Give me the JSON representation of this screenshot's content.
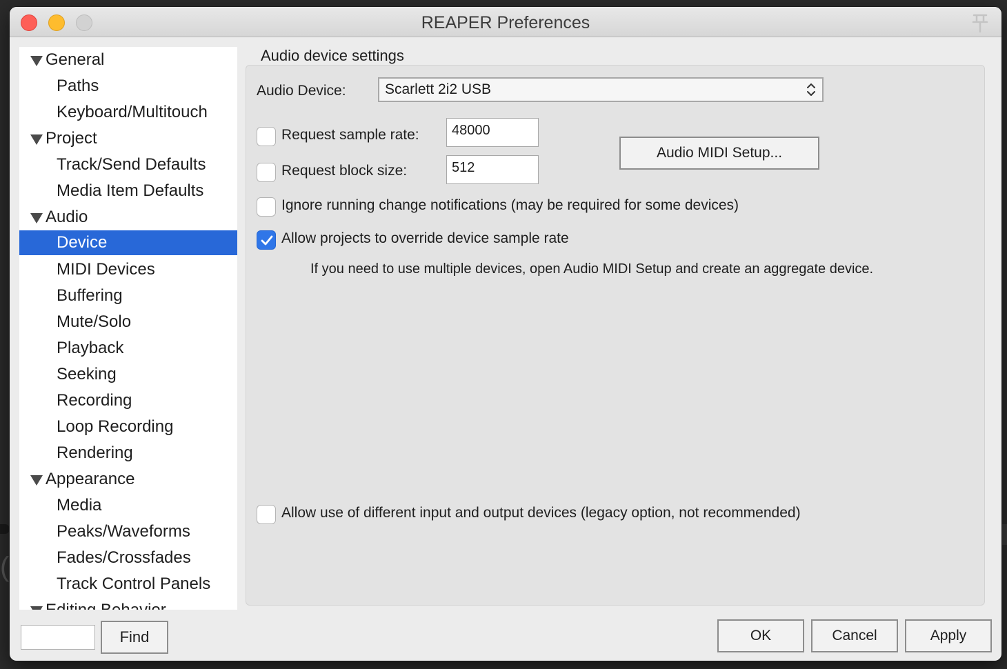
{
  "window": {
    "title": "REAPER Preferences"
  },
  "sidebar": {
    "items": [
      {
        "label": "General",
        "kind": "parent"
      },
      {
        "label": "Paths",
        "kind": "child"
      },
      {
        "label": "Keyboard/Multitouch",
        "kind": "child"
      },
      {
        "label": "Project",
        "kind": "parent"
      },
      {
        "label": "Track/Send Defaults",
        "kind": "child"
      },
      {
        "label": "Media Item Defaults",
        "kind": "child"
      },
      {
        "label": "Audio",
        "kind": "parent"
      },
      {
        "label": "Device",
        "kind": "child",
        "selected": true
      },
      {
        "label": "MIDI Devices",
        "kind": "child"
      },
      {
        "label": "Buffering",
        "kind": "child"
      },
      {
        "label": "Mute/Solo",
        "kind": "child"
      },
      {
        "label": "Playback",
        "kind": "child"
      },
      {
        "label": "Seeking",
        "kind": "child"
      },
      {
        "label": "Recording",
        "kind": "child"
      },
      {
        "label": "Loop Recording",
        "kind": "child"
      },
      {
        "label": "Rendering",
        "kind": "child"
      },
      {
        "label": "Appearance",
        "kind": "parent"
      },
      {
        "label": "Media",
        "kind": "child"
      },
      {
        "label": "Peaks/Waveforms",
        "kind": "child"
      },
      {
        "label": "Fades/Crossfades",
        "kind": "child"
      },
      {
        "label": "Track Control Panels",
        "kind": "child"
      },
      {
        "label": "Editing Behavior",
        "kind": "parent"
      }
    ],
    "find": {
      "value": "",
      "button_label": "Find"
    }
  },
  "main": {
    "section_title": "Audio device settings",
    "audio_device": {
      "label": "Audio Device:",
      "value": "Scarlett 2i2 USB"
    },
    "sample_rate": {
      "label": "Request sample rate:",
      "checked": false,
      "value": "48000"
    },
    "block_size": {
      "label": "Request block size:",
      "checked": false,
      "value": "512"
    },
    "midi_setup_button": "Audio MIDI Setup...",
    "ignore_notifications": {
      "label": "Ignore running change notifications (may be required for some devices)",
      "checked": false
    },
    "allow_override": {
      "label": "Allow projects to override device sample rate",
      "checked": true
    },
    "hint": "If you need to use multiple devices, open Audio MIDI Setup and create an aggregate device.",
    "allow_different_devices": {
      "label": "Allow use of different input and output devices (legacy option, not recommended)",
      "checked": false
    }
  },
  "footer": {
    "ok_label": "OK",
    "cancel_label": "Cancel",
    "apply_label": "Apply"
  },
  "colors": {
    "selection": "#2868d8",
    "checkbox_checked": "#2f76e8"
  }
}
